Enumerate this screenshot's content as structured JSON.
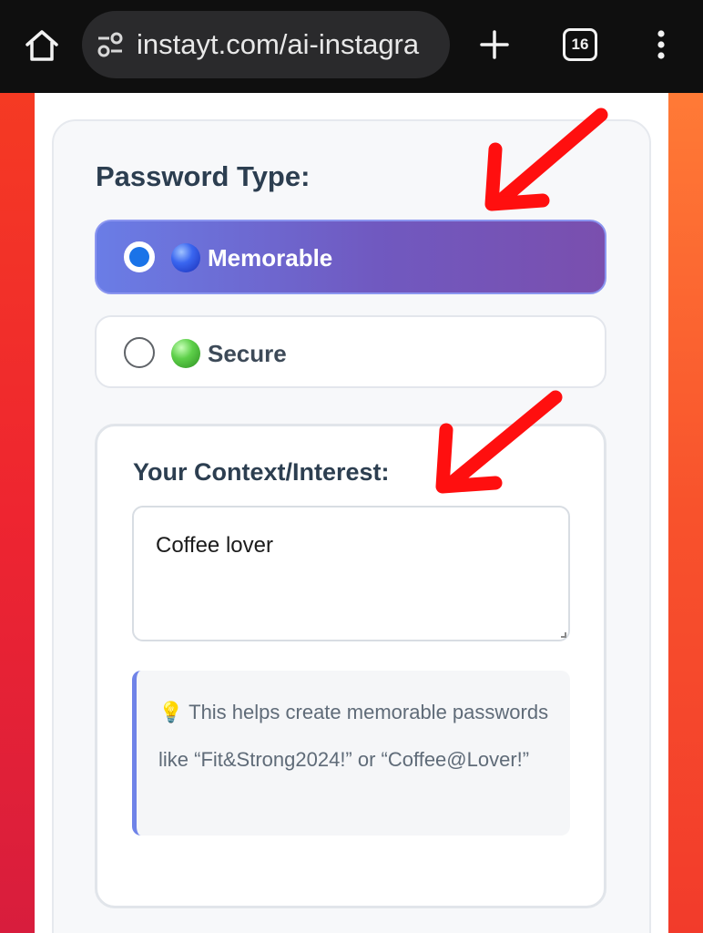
{
  "browser": {
    "url": "instayt.com/ai-instagra",
    "tab_count": "16"
  },
  "form": {
    "section_title": "Password Type:",
    "options": [
      {
        "label": "Memorable",
        "selected": true,
        "orb_color": "#3a66f0"
      },
      {
        "label": "Secure",
        "selected": false,
        "orb_color": "#5ed04a"
      }
    ],
    "context": {
      "title": "Your Context/Interest:",
      "value": "Coffee lover",
      "hint": "This helps create memorable passwords like “Fit&Strong2024!” or “Coffee@Lover!”"
    }
  },
  "colors": {
    "accent": "#6a7de6",
    "annotation_arrow": "#ff0f0f"
  }
}
